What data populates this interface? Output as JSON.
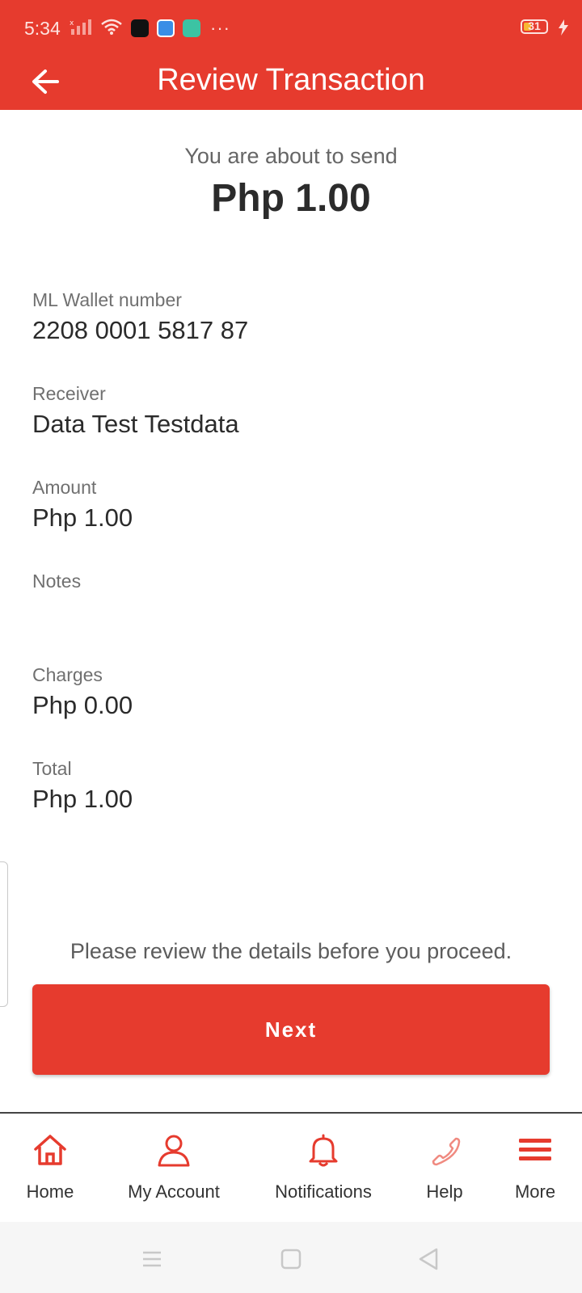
{
  "status_bar": {
    "time": "5:34",
    "battery": "31",
    "overflow": "···",
    "icons": [
      "signal-icon",
      "wifi-icon",
      "app-notification-icon",
      "battery-icon",
      "charging-icon"
    ]
  },
  "header": {
    "title": "Review Transaction",
    "back_icon": "arrow-left-icon"
  },
  "summary": {
    "subtitle": "You are about to send",
    "amount": "Php 1.00"
  },
  "details": {
    "wallet": {
      "label": "ML Wallet number",
      "value": "2208 0001 5817 87"
    },
    "receiver": {
      "label": "Receiver",
      "value": "Data Test Testdata"
    },
    "amount": {
      "label": "Amount",
      "value": "Php 1.00"
    },
    "notes": {
      "label": "Notes",
      "value": ""
    },
    "charges": {
      "label": "Charges",
      "value": "Php 0.00"
    },
    "total": {
      "label": "Total",
      "value": "Php 1.00"
    }
  },
  "footer": {
    "note": "Please review the details before you proceed.",
    "next_label": "Next"
  },
  "bottom_nav": [
    {
      "label": "Home",
      "icon": "home-icon"
    },
    {
      "label": "My Account",
      "icon": "user-icon"
    },
    {
      "label": "Notifications",
      "icon": "bell-icon"
    },
    {
      "label": "Help",
      "icon": "phone-icon"
    },
    {
      "label": "More",
      "icon": "menu-icon"
    }
  ],
  "colors": {
    "accent": "#e63b2e",
    "text_dark": "#2b2b2b",
    "text_muted": "#707070"
  }
}
